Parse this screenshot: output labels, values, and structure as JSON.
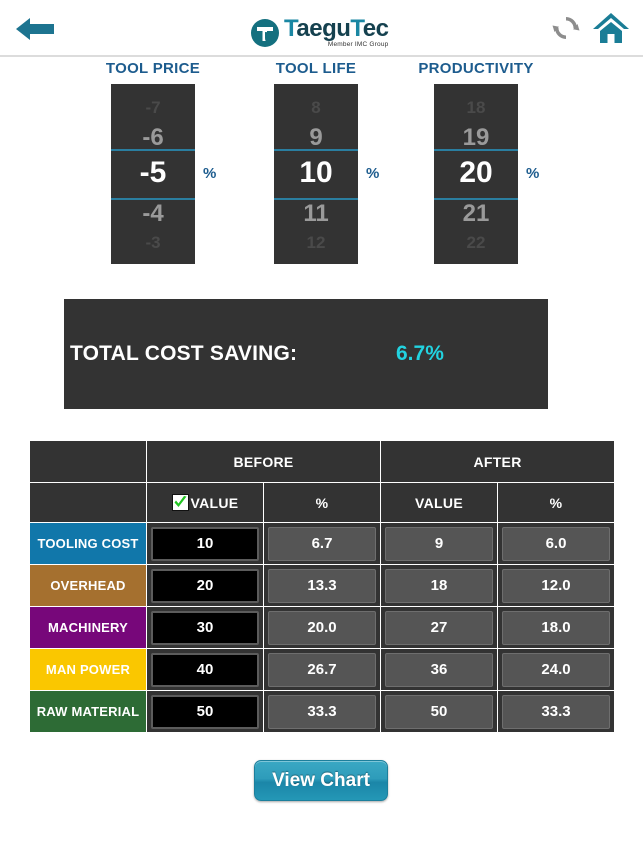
{
  "header": {
    "back_icon": "back-arrow-icon",
    "logo_text_1": "T",
    "logo_text_2": "aegu",
    "logo_text_3": "T",
    "logo_text_4": "ec",
    "logo_subtitle": "Member IMC Group",
    "refresh_icon": "refresh-icon",
    "home_icon": "home-icon",
    "accent_teal": "#1a87a3"
  },
  "pickers": [
    {
      "title": "TOOL PRICE",
      "unit": "%",
      "selected": "-5",
      "visible": [
        "-7",
        "-6",
        "-5",
        "-4",
        "-3"
      ]
    },
    {
      "title": "TOOL LIFE",
      "unit": "%",
      "selected": "10",
      "visible": [
        "8",
        "9",
        "10",
        "11",
        "12"
      ]
    },
    {
      "title": "PRODUCTIVITY",
      "unit": "%",
      "selected": "20",
      "visible": [
        "18",
        "19",
        "20",
        "21",
        "22"
      ]
    }
  ],
  "saving": {
    "label": "TOTAL COST SAVING:",
    "value": "6.7%",
    "value_color": "#22d3e0"
  },
  "table": {
    "group_headers": [
      "BEFORE",
      "AFTER"
    ],
    "sub_headers": {
      "before_value": "VALUE",
      "before_pct": "%",
      "after_value": "VALUE",
      "after_pct": "%"
    },
    "checkbox_checked": true,
    "rows": [
      {
        "label": "TOOLING COST",
        "color": "#1177aa",
        "before_value": "10",
        "before_pct": "6.7",
        "after_value": "9",
        "after_pct": "6.0"
      },
      {
        "label": "OVERHEAD",
        "color": "#a5702f",
        "before_value": "20",
        "before_pct": "13.3",
        "after_value": "18",
        "after_pct": "12.0"
      },
      {
        "label": "MACHINERY",
        "color": "#77077a",
        "before_value": "30",
        "before_pct": "20.0",
        "after_value": "27",
        "after_pct": "18.0"
      },
      {
        "label": "MAN POWER",
        "color": "#fac700",
        "before_value": "40",
        "before_pct": "26.7",
        "after_value": "36",
        "after_pct": "24.0"
      },
      {
        "label": "RAW MATERIAL",
        "color": "#2d6b35",
        "before_value": "50",
        "before_pct": "33.3",
        "after_value": "50",
        "after_pct": "33.3"
      }
    ]
  },
  "footer": {
    "view_chart_label": "View Chart"
  }
}
